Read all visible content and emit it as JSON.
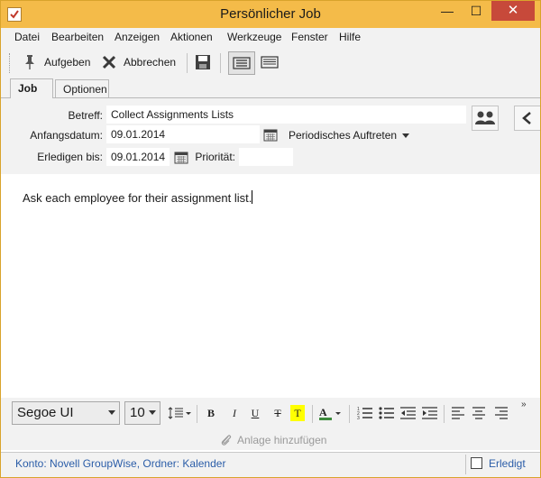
{
  "window": {
    "title": "Persönlicher Job",
    "min_glyph": "—",
    "max_glyph": "☐",
    "close_glyph": "✕"
  },
  "menu": [
    "Datei",
    "Bearbeiten",
    "Anzeigen",
    "Aktionen",
    "Werkzeuge",
    "Fenster",
    "Hilfe"
  ],
  "toolbar": {
    "delegate_label": "Aufgeben",
    "cancel_label": "Abbrechen"
  },
  "tabs": [
    {
      "label": "Job",
      "active": true
    },
    {
      "label": "Optionen",
      "active": false
    }
  ],
  "form": {
    "subject_label": "Betreff:",
    "subject_value": "Collect Assignments Lists",
    "start_label": "Anfangsdatum:",
    "start_value": "09.01.2014",
    "recurrence_label": "Periodisches Auftreten",
    "due_label": "Erledigen bis:",
    "due_value": "09.01.2014",
    "priority_label": "Priorität:",
    "priority_value": ""
  },
  "body": {
    "text": "Ask each employee for their assignment list."
  },
  "format": {
    "font": "Segoe UI",
    "size": "10",
    "bold": "B",
    "italic": "I",
    "underline": "U",
    "strike": "T",
    "highlight": "T",
    "overflow": "»"
  },
  "attachment": {
    "label": "Anlage hinzufügen"
  },
  "status": {
    "text": "Konto: Novell GroupWise,  Ordner: Kalender",
    "done_label": "Erledigt"
  },
  "colors": {
    "titlebar": "#f4bb49",
    "status_text": "#2b5da8",
    "highlight": "#ffff00"
  }
}
